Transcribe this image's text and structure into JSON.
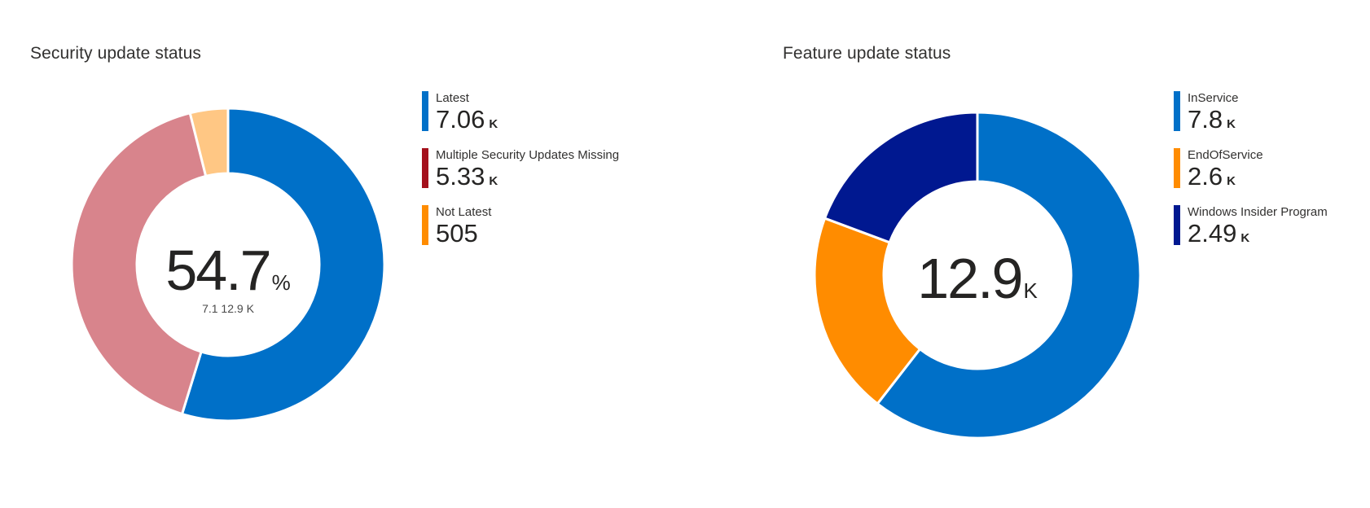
{
  "chart_data": [
    {
      "type": "pie",
      "title": "Security update status",
      "center": {
        "value": "54.7",
        "unit": "%",
        "sub": "7.1 12.9 K"
      },
      "categories": [
        "Latest",
        "Multiple Security Updates Missing",
        "Not Latest"
      ],
      "values": [
        7060,
        5330,
        505
      ],
      "value_labels": [
        {
          "value": "7.06",
          "unit": "K"
        },
        {
          "value": "5.33",
          "unit": "K"
        },
        {
          "value": "505",
          "unit": ""
        }
      ],
      "legend_colors": [
        "#0070C8",
        "#A4101C",
        "#FF8C00"
      ],
      "slice_colors": [
        "#0070C8",
        "#D8848C",
        "#FFC784"
      ],
      "legend": "right"
    },
    {
      "type": "pie",
      "title": "Feature update status",
      "center": {
        "value": "12.9",
        "unit": "K",
        "sub": ""
      },
      "categories": [
        "InService",
        "EndOfService",
        "Windows Insider Program"
      ],
      "values": [
        7800,
        2600,
        2490
      ],
      "value_labels": [
        {
          "value": "7.8",
          "unit": "K"
        },
        {
          "value": "2.6",
          "unit": "K"
        },
        {
          "value": "2.49",
          "unit": "K"
        }
      ],
      "legend_colors": [
        "#0070C8",
        "#FF8C00",
        "#001890"
      ],
      "slice_colors": [
        "#0070C8",
        "#FF8C00",
        "#001890"
      ],
      "legend": "right"
    }
  ]
}
